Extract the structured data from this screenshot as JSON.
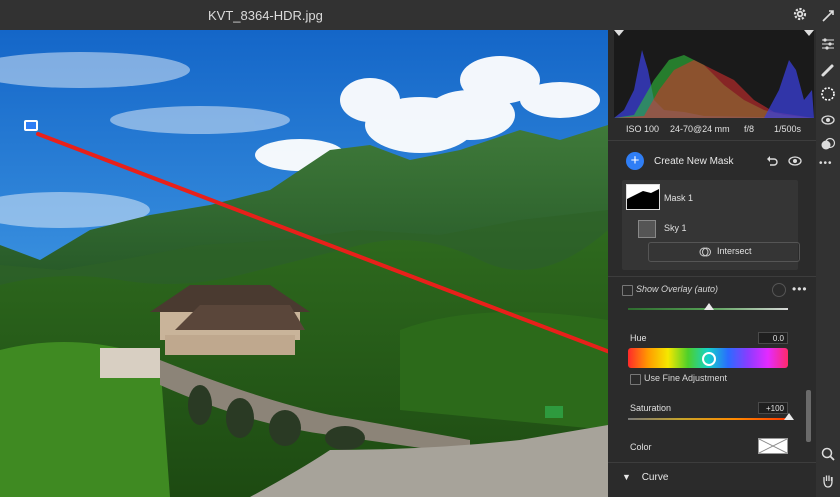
{
  "window": {
    "title": "KVT_8364-HDR.jpg"
  },
  "histogram": {
    "iso": "ISO 100",
    "lens": "24-70@24 mm",
    "aperture": "f/8",
    "shutter": "1/500s"
  },
  "masks": {
    "create_label": "Create New Mask",
    "mask1_label": "Mask 1",
    "sky_label": "Sky 1",
    "intersect_label": "Intersect"
  },
  "overlay": {
    "label": "Show Overlay (auto)"
  },
  "adjustments": {
    "hue_label": "Hue",
    "hue_value": "0.0",
    "fine_adjust_label": "Use Fine Adjustment",
    "saturation_label": "Saturation",
    "saturation_value": "+100",
    "color_label": "Color",
    "curve_label": "Curve"
  },
  "icons": {
    "settings": "gear-icon",
    "photo_marker": "image-icon",
    "tools": [
      "edit-icon",
      "sliders-icon",
      "brush-icon",
      "mask-icon",
      "redeye-icon",
      "presets-icon",
      "more-icon",
      "zoom-icon",
      "hand-icon"
    ]
  },
  "colors": {
    "accent": "#2f7ef5",
    "annotation": "#e8201a"
  }
}
